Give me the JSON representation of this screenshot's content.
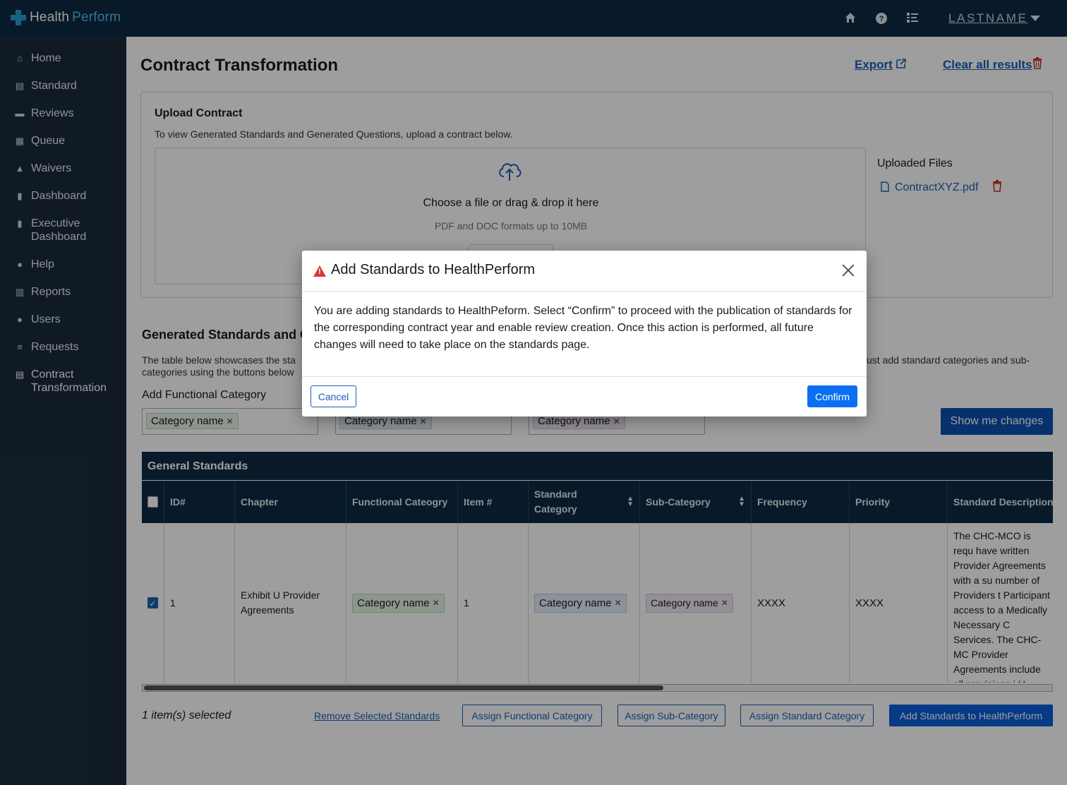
{
  "app": {
    "brand_health": "Health",
    "brand_perform": "Perform",
    "user_name": "LASTNAME"
  },
  "topbar": {
    "icons": [
      "home-icon",
      "help-icon",
      "checklist-icon"
    ]
  },
  "sidebar": {
    "items": [
      {
        "label": "Home",
        "icon": "home-icon"
      },
      {
        "label": "Standard",
        "icon": "book-icon"
      },
      {
        "label": "Reviews",
        "icon": "briefcase-icon"
      },
      {
        "label": "Queue",
        "icon": "grid-icon"
      },
      {
        "label": "Waivers",
        "icon": "warning-icon"
      },
      {
        "label": "Dashboard",
        "icon": "bar-chart-icon"
      },
      {
        "label": "Executive Dashboard",
        "icon": "bar-chart-icon"
      },
      {
        "label": "Help",
        "icon": "help-icon"
      },
      {
        "label": "Reports",
        "icon": "report-icon"
      },
      {
        "label": "Users",
        "icon": "user-icon"
      },
      {
        "label": "Requests",
        "icon": "list-icon"
      },
      {
        "label": "Contract Transformation",
        "icon": "document-icon"
      }
    ]
  },
  "main": {
    "title": "Contract Transformation",
    "export_label": "Export",
    "clear_label": "Clear all results",
    "upload": {
      "title": "Upload Contract",
      "subtitle": "To view Generated Standards and Generated Questions, upload a contract below.",
      "drop_text": "Choose a file or drag & drop it here",
      "drop_hint": "PDF and DOC formats up to 10MB",
      "uploaded_title": "Uploaded Files",
      "file_name": "ContractXYZ.pdf"
    },
    "generated": {
      "title_visible": "Generated Standards and G",
      "desc_left": "The table below showcases the sta",
      "desc_right": "ust add standard categories and sub-",
      "desc_line2": "categories using the buttons below",
      "functional_label": "Add Functional Category",
      "chip_label": "Category name",
      "show_changes": "Show me changes"
    },
    "table": {
      "caption": "General Standards",
      "headers": [
        "ID#",
        "Chapter",
        "Functional Cateogry",
        "Item #",
        "Standard Category",
        "Sub-Category",
        "Frequency",
        "Priority",
        "Standard Description"
      ],
      "row": {
        "id": "1",
        "chapter": "Exhibit U Provider Agreements",
        "functional": "Category name",
        "item": "1",
        "standard_category": "Category name",
        "sub_category": "Category name",
        "frequency": "XXXX",
        "priority": "XXXX",
        "description": "The CHC-MCO is requ have written Provider Agreements with a su number of Providers t Participant access to a Medically Necessary C Services. The CHC-MC Provider Agreements include all provisions i U “Provider Agreemer"
      }
    },
    "footer": {
      "selected": "1 item(s) selected",
      "remove": "Remove Selected Standards",
      "assign_functional": "Assign Functional Category",
      "assign_sub": "Assign Sub-Category",
      "assign_standard": "Assign Standard Category",
      "add_standards": "Add Standards to HealthPerform"
    }
  },
  "modal": {
    "title": "Add Standards to HealthPerform",
    "body": "You are adding standards to HealthPeform. Select “Confirm” to proceed with the publication of standards for the corresponding contract year and enable review creation. Once this action is performed, all future changes will need to take place on the standards page.",
    "cancel": "Cancel",
    "confirm": "Confirm"
  },
  "colors": {
    "topbar": "#0d2a45",
    "sidebar": "#1b2b3b",
    "primary": "#0b5cd8",
    "link": "#1a5fb4",
    "danger": "#d83933"
  }
}
